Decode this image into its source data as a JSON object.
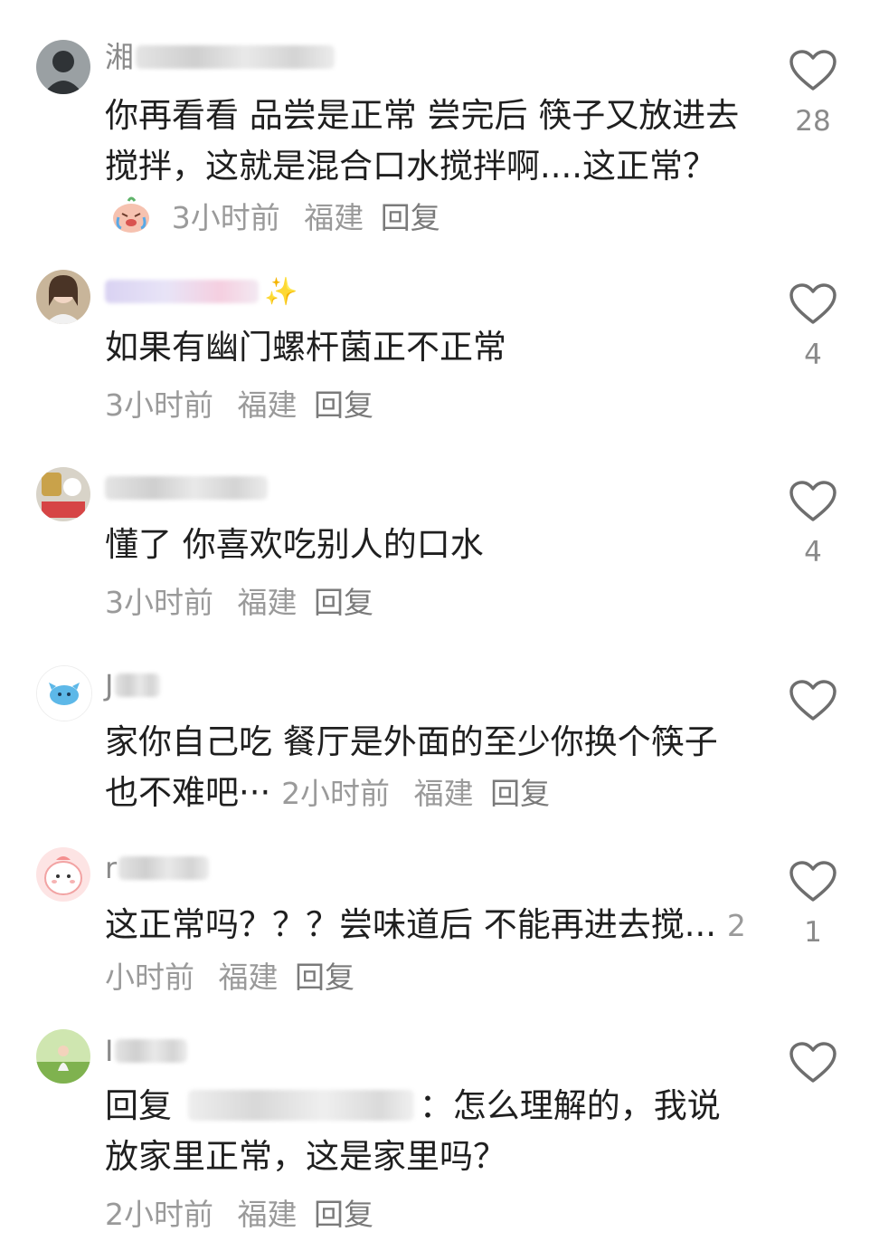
{
  "comments": [
    {
      "user_initial": "湘",
      "text": "你再看看 品尝是正常 尝完后 筷子又放进去搅拌，这就是混合口水搅拌啊....这正常？",
      "emoji": "crying-face",
      "time": "3小时前",
      "location": "福建",
      "reply": "回复",
      "likes": "28"
    },
    {
      "user_initial": "",
      "text": "如果有幽门螺杆菌正不正常",
      "time": "3小时前",
      "location": "福建",
      "reply": "回复",
      "likes": "4"
    },
    {
      "user_initial": "",
      "text": "懂了 你喜欢吃别人的口水",
      "time": "3小时前",
      "location": "福建",
      "reply": "回复",
      "likes": "4"
    },
    {
      "user_initial": "J",
      "text": "家你自己吃 餐厅是外面的至少你换个筷子也不难吧···",
      "time": "2小时前",
      "location": "福建",
      "reply": "回复",
      "likes": ""
    },
    {
      "user_initial": "r",
      "text": "这正常吗？？？尝味道后 不能再进去搅...",
      "time": "2小时前",
      "location": "福建",
      "reply": "回复",
      "likes": "1"
    },
    {
      "user_initial": "I",
      "reply_prefix": "回复",
      "text": "：怎么理解的，我说放家里正常，这是家里吗？",
      "time": "2小时前",
      "location": "福建",
      "reply": "回复",
      "likes": ""
    }
  ]
}
